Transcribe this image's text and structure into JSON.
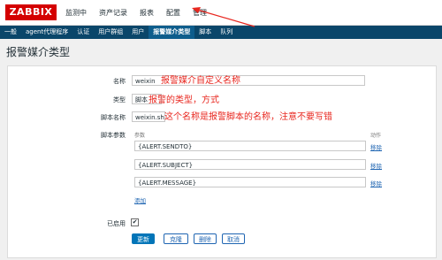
{
  "topbar": {
    "logo": "ZABBIX",
    "nav": [
      "监测中",
      "资产记录",
      "报表",
      "配置",
      "管理"
    ]
  },
  "subnav": {
    "items": [
      "一般",
      "agent代理程序",
      "认证",
      "用户群组",
      "用户",
      "报警媒介类型",
      "脚本",
      "队列"
    ],
    "active_index": 5
  },
  "page": {
    "title": "报警媒介类型"
  },
  "form": {
    "name_label": "名称",
    "name_value": "weixin",
    "name_annotation": "报警媒介自定义名称",
    "type_label": "类型",
    "type_value": "脚本",
    "type_annotation": "报警的类型，方式",
    "script_label": "脚本名称",
    "script_value": "weixin.sh",
    "script_annotation": "这个名称是报警脚本的名称，注意不要写错",
    "params_label": "脚本参数",
    "params_header_param": "参数",
    "params_header_action": "动作",
    "params": [
      {
        "value": "{ALERT.SENDTO}",
        "action": "移除"
      },
      {
        "value": "{ALERT.SUBJECT}",
        "action": "移除"
      },
      {
        "value": "{ALERT.MESSAGE}",
        "action": "移除"
      }
    ],
    "add_label": "添加",
    "enabled_label": "已启用",
    "enabled_checked": "✔"
  },
  "buttons": {
    "update": "更新",
    "clone": "克隆",
    "delete": "删除",
    "cancel": "取消"
  },
  "colors": {
    "brand": "#d40000",
    "subnav": "#0a466a",
    "primary": "#0275b8",
    "annotation": "#e8271f"
  }
}
